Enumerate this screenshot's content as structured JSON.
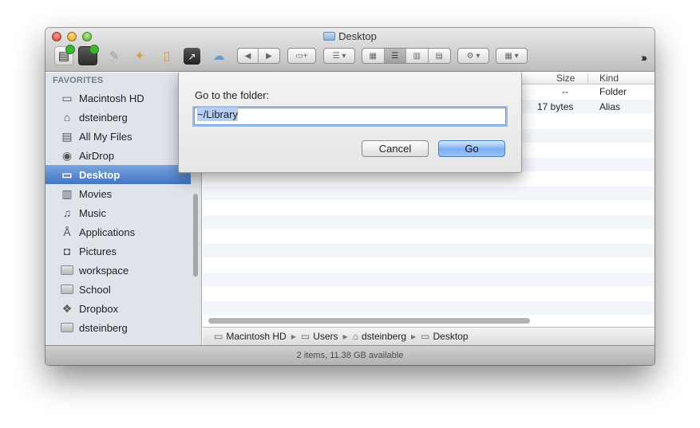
{
  "window": {
    "title": "Desktop",
    "status": "2 items, 11.38 GB available"
  },
  "sidebar": {
    "header": "FAVORITES",
    "items": [
      {
        "label": "Macintosh HD",
        "icon": "hard-drive-icon"
      },
      {
        "label": "dsteinberg",
        "icon": "home-icon"
      },
      {
        "label": "All My Files",
        "icon": "all-files-icon"
      },
      {
        "label": "AirDrop",
        "icon": "airdrop-icon"
      },
      {
        "label": "Desktop",
        "icon": "desktop-icon",
        "selected": true
      },
      {
        "label": "Movies",
        "icon": "film-icon"
      },
      {
        "label": "Music",
        "icon": "music-note-icon"
      },
      {
        "label": "Applications",
        "icon": "applications-icon"
      },
      {
        "label": "Pictures",
        "icon": "camera-icon"
      },
      {
        "label": "workspace",
        "icon": "folder-icon"
      },
      {
        "label": "School",
        "icon": "folder-icon"
      },
      {
        "label": "Dropbox",
        "icon": "dropbox-icon"
      },
      {
        "label": "dsteinberg",
        "icon": "folder-icon"
      }
    ]
  },
  "columns": {
    "size": "Size",
    "kind": "Kind"
  },
  "rows": [
    {
      "size": "--",
      "kind": "Folder"
    },
    {
      "size": "17 bytes",
      "kind": "Alias"
    }
  ],
  "pathbar": {
    "items": [
      "Macintosh HD",
      "Users",
      "dsteinberg",
      "Desktop"
    ]
  },
  "sheet": {
    "label": "Go to the folder:",
    "value": "~/Library",
    "cancel": "Cancel",
    "go": "Go"
  }
}
